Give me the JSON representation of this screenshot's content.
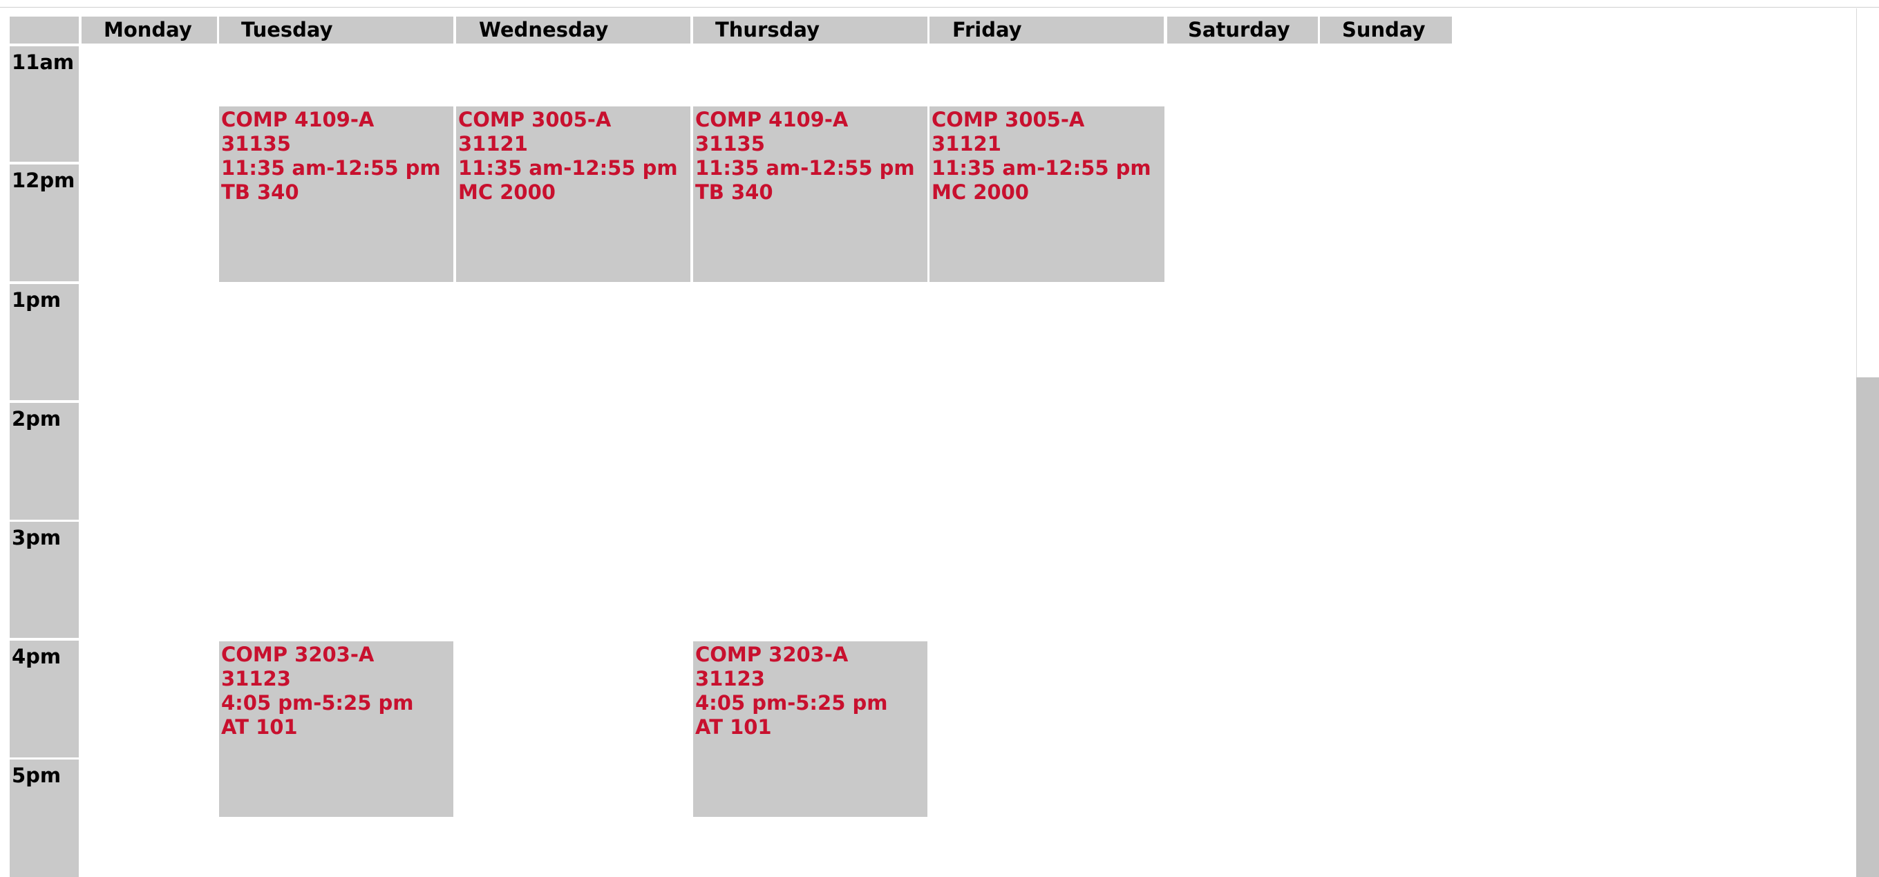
{
  "days": [
    "Monday",
    "Tuesday",
    "Wednesday",
    "Thursday",
    "Friday",
    "Saturday",
    "Sunday"
  ],
  "times": [
    "11am",
    "12pm",
    "1pm",
    "2pm",
    "3pm",
    "4pm",
    "5pm"
  ],
  "events": [
    {
      "day": "Tuesday",
      "course": "COMP 4109-A",
      "crn": "31135",
      "time": "11:35 am-12:55 pm",
      "room": "TB 340"
    },
    {
      "day": "Wednesday",
      "course": "COMP 3005-A",
      "crn": "31121",
      "time": "11:35 am-12:55 pm",
      "room": "MC 2000"
    },
    {
      "day": "Thursday",
      "course": "COMP 4109-A",
      "crn": "31135",
      "time": "11:35 am-12:55 pm",
      "room": "TB 340"
    },
    {
      "day": "Friday",
      "course": "COMP 3005-A",
      "crn": "31121",
      "time": "11:35 am-12:55 pm",
      "room": "MC 2000"
    },
    {
      "day": "Tuesday",
      "course": "COMP 3203-A",
      "crn": "31123",
      "time": "4:05 pm-5:25 pm",
      "room": "AT 101"
    },
    {
      "day": "Thursday",
      "course": "COMP 3203-A",
      "crn": "31123",
      "time": "4:05 pm-5:25 pm",
      "room": "AT 101"
    }
  ],
  "colors": {
    "cell_bg": "#c9c9c9",
    "event_text": "#c8102e"
  }
}
